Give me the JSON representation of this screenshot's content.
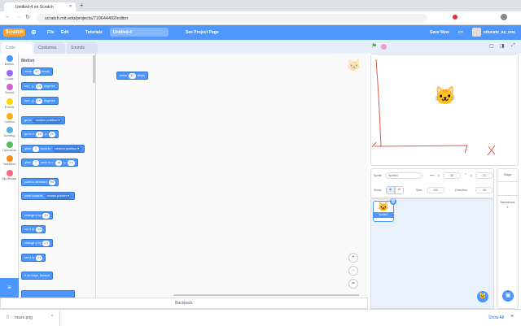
{
  "browser": {
    "tab_title": "Untitled-4 on Scratch",
    "url": "scratch.mit.edu/projects/710644402/editor"
  },
  "menu": {
    "logo": "Scratch",
    "file": "File",
    "edit": "Edit",
    "tutorials": "Tutorials",
    "project_title": "Untitled-4",
    "see_project_page": "See Project Page",
    "save_now": "Save Now",
    "username": "educate_as_one"
  },
  "tabs": [
    "Code",
    "Costumes",
    "Sounds"
  ],
  "categories": [
    {
      "label": "Motion",
      "color": "#4c97ff"
    },
    {
      "label": "Looks",
      "color": "#9966ff"
    },
    {
      "label": "Sound",
      "color": "#cf63cf"
    },
    {
      "label": "Events",
      "color": "#ffd500"
    },
    {
      "label": "Control",
      "color": "#ffab19"
    },
    {
      "label": "Sensing",
      "color": "#5cb1d6"
    },
    {
      "label": "Operators",
      "color": "#59c059"
    },
    {
      "label": "Variables",
      "color": "#ff8c1a"
    },
    {
      "label": "My Blocks",
      "color": "#ff6680"
    }
  ],
  "palette": {
    "heading": "Motion",
    "blocks": {
      "move": [
        "move",
        "10",
        "steps"
      ],
      "turn_cw": [
        "turn",
        "↻",
        "15",
        "degrees"
      ],
      "turn_ccw": [
        "turn",
        "↺",
        "15",
        "degrees"
      ],
      "goto": [
        "go to",
        "random position ▾"
      ],
      "gotoxy": [
        "go to x:",
        "16",
        "y:",
        "21"
      ],
      "glide_rand": [
        "glide",
        "1",
        "secs to",
        "random position ▾"
      ],
      "glide_xy": [
        "glide",
        "1",
        "secs to x:",
        "16",
        "y:",
        "21"
      ],
      "point_dir": [
        "point in direction",
        "90"
      ],
      "point_towards": [
        "point towards",
        "mouse-pointer ▾"
      ],
      "change_x": [
        "change x by",
        "10"
      ],
      "set_x": [
        "set x to",
        "16"
      ],
      "change_y": [
        "change y by",
        "10"
      ],
      "set_y": [
        "set y to",
        "21"
      ],
      "bounce": [
        "if on edge, bounce"
      ]
    }
  },
  "script": {
    "move": [
      "move",
      "10",
      "steps"
    ]
  },
  "sprite_info": {
    "sprite_label": "Sprite",
    "sprite_name": "Sprite1",
    "x_label": "x",
    "x": "16",
    "y_label": "y",
    "y": "21",
    "show_label": "Show",
    "size_label": "Size",
    "size": "100",
    "direction_label": "Direction",
    "direction": "90"
  },
  "sprites": [
    {
      "name": "Sprite1"
    }
  ],
  "stage_pane": {
    "title": "Stage",
    "backdrops_label": "Backdrops",
    "backdrops_count": "1"
  },
  "stage_drawing": {
    "axis_label": "X"
  },
  "backpack": "Backpack",
  "download": {
    "file": "maze.png",
    "show_all": "Show All"
  }
}
